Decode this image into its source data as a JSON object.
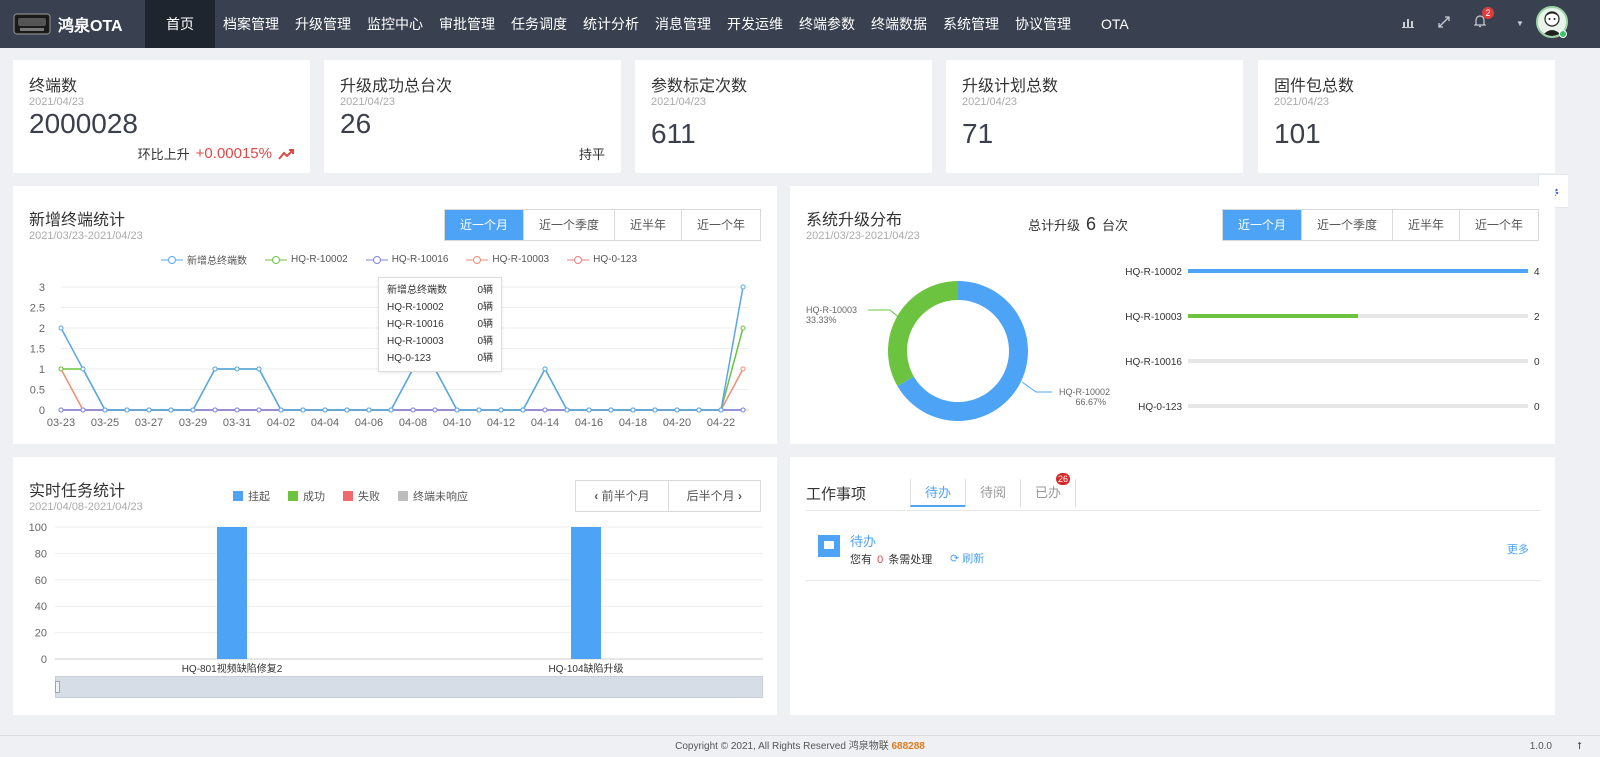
{
  "app": {
    "title": "鸿泉OTA"
  },
  "nav": [
    "首页",
    "档案管理",
    "升级管理",
    "监控中心",
    "审批管理",
    "任务调度",
    "统计分析",
    "消息管理",
    "开发运维",
    "终端参数",
    "终端数据",
    "系统管理",
    "协议管理",
    "OTA"
  ],
  "header": {
    "notification_count": "2"
  },
  "stats": [
    {
      "title": "终端数",
      "date": "2021/04/23",
      "value": "2000028",
      "trend_label": "环比上升",
      "trend_value": "+0.00015%"
    },
    {
      "title": "升级成功总台次",
      "date": "2021/04/23",
      "value": "26",
      "trend_label": "持平"
    },
    {
      "title": "参数标定次数",
      "date": "2021/04/23",
      "value": "611"
    },
    {
      "title": "升级计划总数",
      "date": "2021/04/23",
      "value": "71"
    },
    {
      "title": "固件包总数",
      "date": "2021/04/23",
      "value": "101"
    }
  ],
  "period_tabs": [
    "近一个月",
    "近一个季度",
    "近半年",
    "近一个年"
  ],
  "new_terminals": {
    "title": "新增终端统计",
    "range": "2021/03/23-2021/04/23",
    "tooltip": [
      {
        "name": "新增总终端数",
        "value": "0辆"
      },
      {
        "name": "HQ-R-10002",
        "value": "0辆"
      },
      {
        "name": "HQ-R-10016",
        "value": "0辆"
      },
      {
        "name": "HQ-R-10003",
        "value": "0辆"
      },
      {
        "name": "HQ-0-123",
        "value": "0辆"
      }
    ]
  },
  "upgrade_dist": {
    "title": "系统升级分布",
    "range": "2021/03/23-2021/04/23",
    "total_prefix": "总计升级",
    "total": "6",
    "total_suffix": "台次",
    "donut_labels": [
      {
        "name": "HQ-R-10003",
        "pct": "33.33%"
      },
      {
        "name": "HQ-R-10002",
        "pct": "66.67%"
      }
    ]
  },
  "tasks": {
    "title": "实时任务统计",
    "range": "2021/04/08-2021/04/23",
    "prev_label": "前半个月",
    "next_label": "后半个月"
  },
  "work": {
    "title": "工作事项",
    "tabs": [
      "待办",
      "待阅",
      "已办"
    ],
    "done_badge": "26",
    "item_title": "待办",
    "item_prefix": "您有",
    "item_count": "0",
    "item_suffix": "条需处理",
    "refresh": "刷新",
    "more": "更多"
  },
  "footer": {
    "text": "Copyright © 2021, All Rights Reserved 鸿泉物联",
    "code": "688288",
    "version": "1.0.0"
  },
  "chart_data": [
    {
      "type": "line",
      "legend": [
        "新增总终端数",
        "HQ-R-10002",
        "HQ-R-10016",
        "HQ-R-10003",
        "HQ-0-123"
      ],
      "colors": [
        "#5aa6ee",
        "#6cc33f",
        "#7b86e6",
        "#ef8c76",
        "#e87c7c"
      ],
      "x": [
        "03-23",
        "03-24",
        "03-25",
        "03-26",
        "03-27",
        "03-28",
        "03-29",
        "03-30",
        "03-31",
        "04-01",
        "04-02",
        "04-03",
        "04-04",
        "04-05",
        "04-06",
        "04-07",
        "04-08",
        "04-09",
        "04-10",
        "04-11",
        "04-12",
        "04-13",
        "04-14",
        "04-15",
        "04-16",
        "04-17",
        "04-18",
        "04-19",
        "04-20",
        "04-21",
        "04-22",
        "04-23"
      ],
      "xticks": [
        "03-23",
        "03-25",
        "03-27",
        "03-29",
        "03-31",
        "04-02",
        "04-04",
        "04-06",
        "04-08",
        "04-10",
        "04-12",
        "04-14",
        "04-16",
        "04-18",
        "04-20",
        "04-22"
      ],
      "yticks": [
        "0",
        "0.5",
        "1",
        "1.5",
        "2",
        "2.5",
        "3"
      ],
      "ylim": [
        0,
        3
      ],
      "series": [
        {
          "name": "新增总终端数",
          "values": [
            2,
            1,
            0,
            0,
            0,
            0,
            0,
            1,
            1,
            1,
            0,
            0,
            0,
            0,
            0,
            0,
            1,
            1,
            0,
            0,
            0,
            0,
            1,
            0,
            0,
            0,
            0,
            0,
            0,
            0,
            0,
            3
          ]
        },
        {
          "name": "HQ-R-10002",
          "values": [
            1,
            1,
            0,
            0,
            0,
            0,
            0,
            1,
            1,
            1,
            0,
            0,
            0,
            0,
            0,
            0,
            1,
            1,
            0,
            0,
            0,
            0,
            1,
            0,
            0,
            0,
            0,
            0,
            0,
            0,
            0,
            2
          ]
        },
        {
          "name": "HQ-R-10016",
          "values": [
            0,
            0,
            0,
            0,
            0,
            0,
            0,
            0,
            0,
            0,
            0,
            0,
            0,
            0,
            0,
            0,
            0,
            0,
            0,
            0,
            0,
            0,
            0,
            0,
            0,
            0,
            0,
            0,
            0,
            0,
            0,
            0
          ]
        },
        {
          "name": "HQ-R-10003",
          "values": [
            1,
            0,
            0,
            0,
            0,
            0,
            0,
            0,
            0,
            0,
            0,
            0,
            0,
            0,
            0,
            0,
            0,
            0,
            0,
            0,
            0,
            0,
            0,
            0,
            0,
            0,
            0,
            0,
            0,
            0,
            0,
            1
          ]
        },
        {
          "name": "HQ-0-123",
          "values": [
            0,
            0,
            0,
            0,
            0,
            0,
            0,
            0,
            0,
            0,
            0,
            0,
            0,
            0,
            0,
            0,
            0,
            0,
            0,
            0,
            0,
            0,
            0,
            0,
            0,
            0,
            0,
            0,
            0,
            0,
            0,
            0
          ]
        }
      ]
    },
    {
      "type": "pie",
      "slices": [
        {
          "name": "HQ-R-10002",
          "value": 4,
          "color": "#4da4f7"
        },
        {
          "name": "HQ-R-10003",
          "value": 2,
          "color": "#6cc33f"
        }
      ]
    },
    {
      "type": "bar",
      "categories": [
        "HQ-R-10002",
        "HQ-R-10003",
        "HQ-R-10016",
        "HQ-0-123"
      ],
      "values": [
        4,
        2,
        0,
        0
      ],
      "max": 4,
      "colors": [
        "#4da4f7",
        "#6cc33f",
        "#cccccc",
        "#cccccc"
      ]
    },
    {
      "type": "bar",
      "legend": [
        {
          "name": "挂起",
          "color": "#4da4f7"
        },
        {
          "name": "成功",
          "color": "#6cc33f"
        },
        {
          "name": "失败",
          "color": "#ef6b6b"
        },
        {
          "name": "终端未响应",
          "color": "#bdbdbd"
        }
      ],
      "categories": [
        "HQ-801视频缺陷修复2",
        "HQ-104缺陷升级"
      ],
      "yticks": [
        "0",
        "20",
        "40",
        "60",
        "80",
        "100"
      ],
      "ylim": [
        0,
        100
      ],
      "series": [
        {
          "name": "挂起",
          "values": [
            100,
            100
          ]
        }
      ]
    }
  ]
}
